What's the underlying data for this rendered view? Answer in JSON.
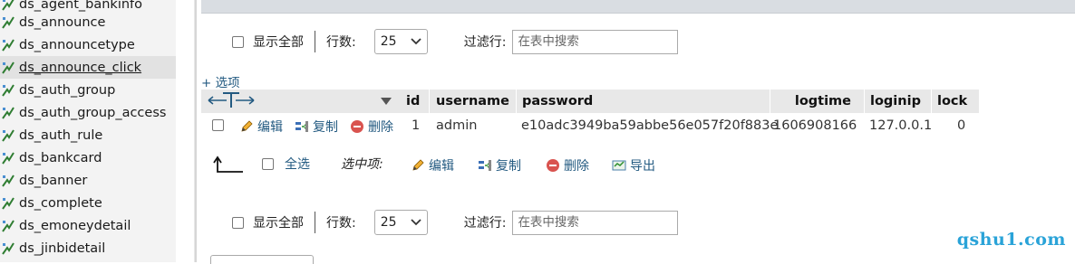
{
  "sidebar": {
    "items": [
      {
        "label": "ds_agent_bankinfo",
        "active": false
      },
      {
        "label": "ds_announce",
        "active": false
      },
      {
        "label": "ds_announcetype",
        "active": false
      },
      {
        "label": "ds_announce_click",
        "active": true
      },
      {
        "label": "ds_auth_group",
        "active": false
      },
      {
        "label": "ds_auth_group_access",
        "active": false
      },
      {
        "label": "ds_auth_rule",
        "active": false
      },
      {
        "label": "ds_bankcard",
        "active": false
      },
      {
        "label": "ds_banner",
        "active": false
      },
      {
        "label": "ds_complete",
        "active": false
      },
      {
        "label": "ds_emoneydetail",
        "active": false
      },
      {
        "label": "ds_jinbidetail",
        "active": false
      }
    ]
  },
  "nav_top": {
    "show_all_label": "显示全部",
    "rows_label": "行数:",
    "rows_value": "25",
    "filter_label": "过滤行:",
    "filter_placeholder": "在表中搜索"
  },
  "nav_bottom": {
    "show_all_label": "显示全部",
    "rows_label": "行数:",
    "rows_value": "25",
    "filter_label": "过滤行:",
    "filter_placeholder": "在表中搜索"
  },
  "options_link": "+ 选项",
  "table": {
    "columns": [
      "id",
      "username",
      "password",
      "logtime",
      "loginip",
      "lock"
    ],
    "row": {
      "edit": "编辑",
      "copy": "复制",
      "delete": "删除",
      "id": "1",
      "username": "admin",
      "password": "e10adc3949ba59abbe56e057f20f883e",
      "logtime": "1606908166",
      "loginip": "127.0.0.1",
      "lock": "0"
    }
  },
  "bulk_actions": {
    "select_all": "全选",
    "with_selected": "选中项:",
    "edit": "编辑",
    "copy": "复制",
    "delete": "删除",
    "export": "导出"
  },
  "watermark": "qshu1.com",
  "colors": {
    "link": "#235a81",
    "sidebar_bg": "#f3f3f3",
    "header_bg": "#e8e8e8",
    "watermark": "#2aa3d8"
  }
}
